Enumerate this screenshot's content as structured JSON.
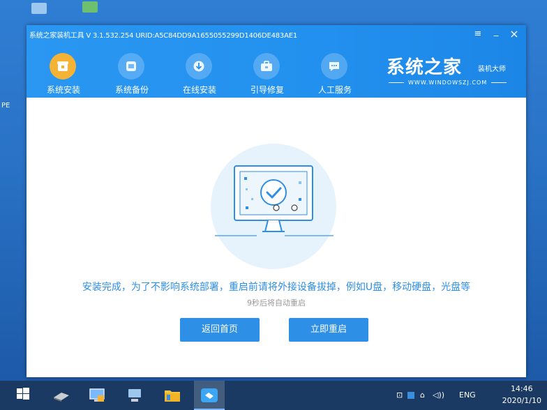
{
  "window": {
    "title": "系统之家装机工具 V 3.1.532.254 URID:A5C84DD9A1655055299D1406DE483AE1",
    "controls": {
      "menu": "≡",
      "minimize": "_",
      "close": "×"
    }
  },
  "nav": {
    "items": [
      {
        "label": "系统安装",
        "icon": "package-icon",
        "active": true
      },
      {
        "label": "系统备份",
        "icon": "backup-icon",
        "active": false
      },
      {
        "label": "在线安装",
        "icon": "download-icon",
        "active": false
      },
      {
        "label": "引导修复",
        "icon": "toolbox-icon",
        "active": false
      },
      {
        "label": "人工服务",
        "icon": "chat-icon",
        "active": false
      }
    ]
  },
  "brand": {
    "name": "系统之家",
    "subtitle": "装机大师",
    "url": "WWW.WINDOWSZJ.COM"
  },
  "content": {
    "message": "安装完成，为了不影响系统部署，重启前请将外接设备拔掉，例如U盘，移动硬盘，光盘等",
    "countdown": "9秒后将自动重启",
    "buttons": {
      "home": "返回首页",
      "restart": "立即重启"
    }
  },
  "taskbar": {
    "tray": {
      "language": "ENG",
      "volume_glyph": "◁))"
    },
    "clock": {
      "time": "14:46",
      "date": "2020/1/10"
    }
  },
  "colors": {
    "header": "#2290ee",
    "accent": "#2d8fe6",
    "active_nav": "#f5b335",
    "taskbar": "#1a3a63"
  }
}
